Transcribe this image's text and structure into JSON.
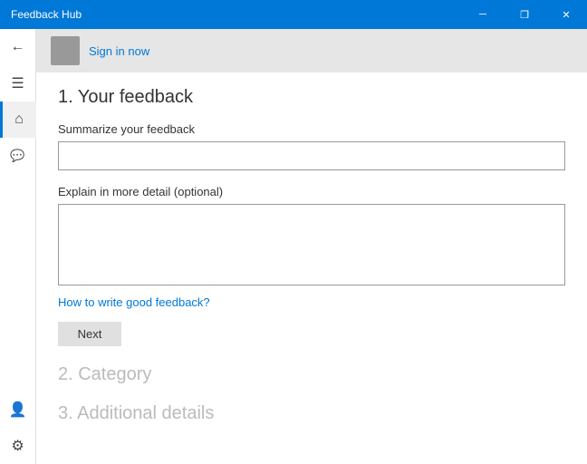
{
  "titlebar": {
    "title": "Feedback Hub",
    "min_label": "─",
    "restore_label": "❐",
    "close_label": "✕"
  },
  "sidebar": {
    "back_label": "←",
    "menu_label": "☰",
    "home_label": "⌂",
    "feedback_label": "💬",
    "account_label": "👤",
    "settings_label": "⚙"
  },
  "signin": {
    "link_text": "Sign in now"
  },
  "feedback_section": {
    "step_label": "1. Your feedback",
    "summarize_label": "Summarize your feedback",
    "summarize_placeholder": "",
    "detail_label": "Explain in more detail (optional)",
    "detail_placeholder": "",
    "help_link": "How to write good feedback?",
    "next_button": "Next"
  },
  "category_section": {
    "step_label": "2. Category"
  },
  "additional_section": {
    "step_label": "3. Additional details"
  }
}
